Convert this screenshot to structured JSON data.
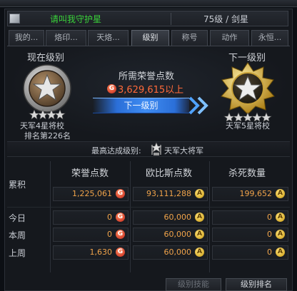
{
  "window": {
    "title": ""
  },
  "character": {
    "name": "请叫我守护星",
    "level_class": "75级 / 剑星"
  },
  "tabs": [
    {
      "label": "我的..."
    },
    {
      "label": "烙印..."
    },
    {
      "label": "天烙..."
    },
    {
      "label": "级别"
    },
    {
      "label": "称号"
    },
    {
      "label": "动作"
    },
    {
      "label": "永恒..."
    }
  ],
  "active_tab": "级别",
  "current_rank": {
    "heading": "现在级别",
    "name": "天军4星将校",
    "ranking": "排名第226名",
    "stars": 4
  },
  "next_rank": {
    "heading": "下一级别",
    "name": "天军5星将校",
    "stars": 5
  },
  "required_honor": {
    "title": "所需荣誉点数",
    "value": "3,629,615以上"
  },
  "next_rank_button": "下一级别",
  "highest_rank": {
    "label": "最高达成级别:",
    "value": "天军大将军"
  },
  "table": {
    "columns": [
      "荣誉点数",
      "欧比斯点数",
      "杀死数量"
    ],
    "rows": [
      {
        "label": "累积",
        "values": [
          "1,225,061",
          "93,111,288",
          "199,652"
        ]
      },
      {
        "label": "今日",
        "values": [
          "0",
          "60,000",
          "0"
        ]
      },
      {
        "label": "本周",
        "values": [
          "0",
          "60,000",
          "0"
        ]
      },
      {
        "label": "上周",
        "values": [
          "1,630",
          "60,000",
          "0"
        ]
      }
    ]
  },
  "icons": {
    "honor": "G",
    "abyss": "A"
  },
  "buttons": {
    "rank_skills": "级别技能",
    "rank_ranking": "级别排名"
  },
  "colors": {
    "name_green": "#3ad23a",
    "honor_orange": "#ff6a3a",
    "button_blue": "#3f8cf2"
  }
}
